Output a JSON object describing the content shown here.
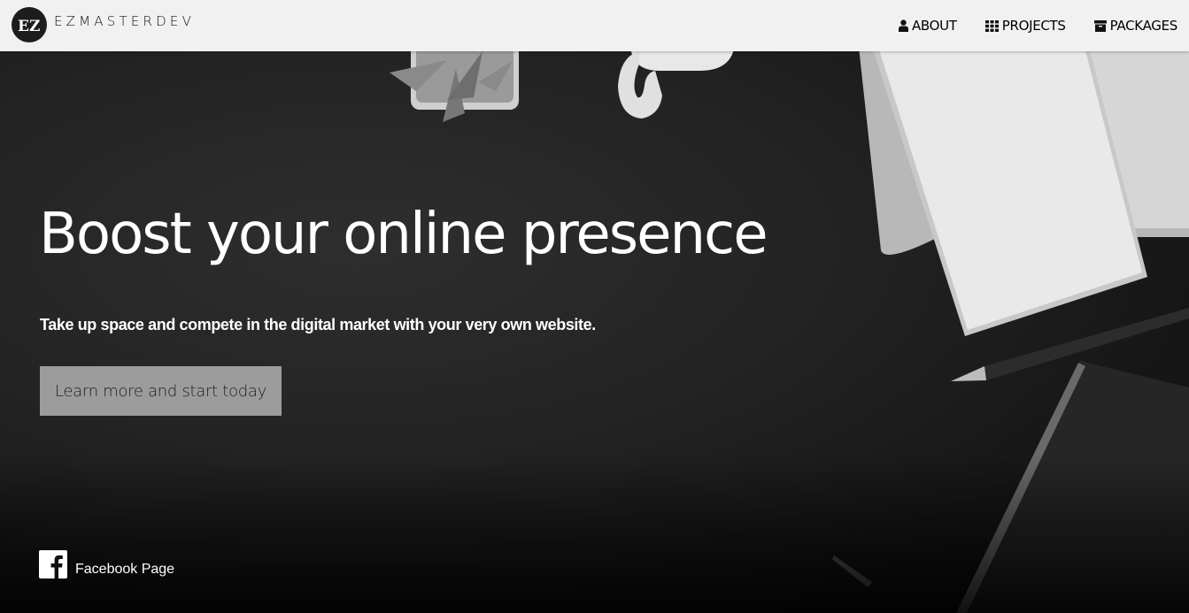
{
  "brand": {
    "logo_text": "EZ",
    "name": "EZMASTERDEV"
  },
  "nav": {
    "items": [
      {
        "label": "ABOUT",
        "icon": "user-icon"
      },
      {
        "label": "PROJECTS",
        "icon": "grid-icon"
      },
      {
        "label": "PACKAGES",
        "icon": "archive-box-icon"
      }
    ]
  },
  "hero": {
    "headline": "Boost your online presence",
    "subline": "Take up space and compete in the digital market with your very own website.",
    "cta_label": "Learn more and start today"
  },
  "social": {
    "facebook_label": "Facebook Page",
    "icon": "facebook-icon"
  },
  "colors": {
    "topbar_bg": "#f1f1f1",
    "hero_bg": "#1e1e1e",
    "cta_bg": "#9c9c9c",
    "text_light": "#ffffff"
  }
}
